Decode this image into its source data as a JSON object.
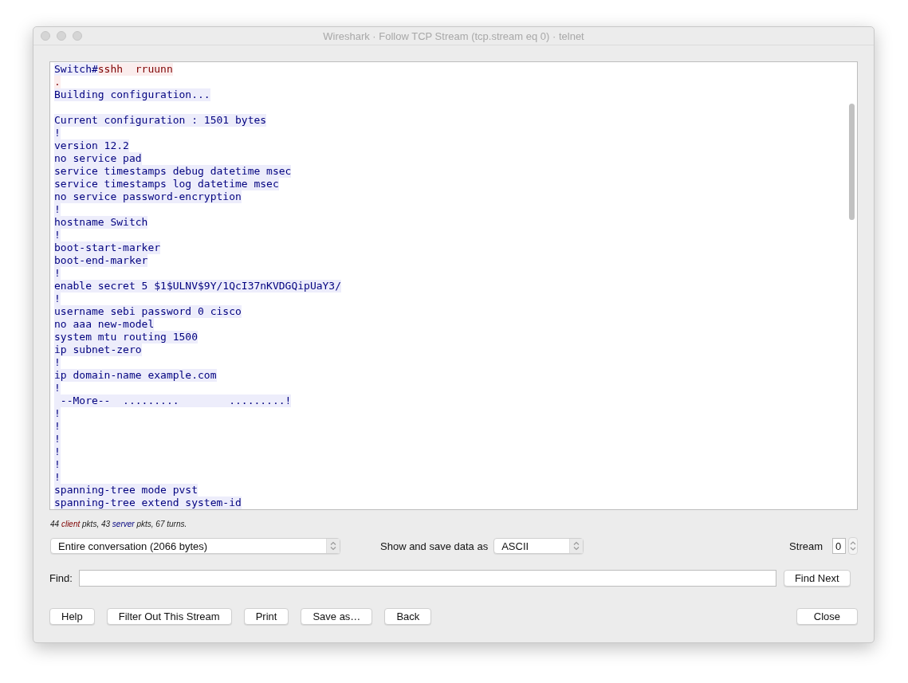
{
  "window": {
    "title": "Wireshark · Follow TCP Stream (tcp.stream eq 0) · telnet"
  },
  "stream": {
    "lines": [
      {
        "segments": [
          {
            "kind": "server",
            "text": "Switch#"
          },
          {
            "kind": "client",
            "text": "sshh  rruunn"
          }
        ]
      },
      {
        "segments": [
          {
            "kind": "client",
            "text": "."
          }
        ]
      },
      {
        "segments": [
          {
            "kind": "server",
            "text": "Building configuration..."
          }
        ]
      },
      {
        "gap_before": true,
        "segments": [
          {
            "kind": "server",
            "text": "Current configuration : 1501 bytes"
          }
        ]
      },
      {
        "segments": [
          {
            "kind": "server",
            "text": "!"
          }
        ]
      },
      {
        "segments": [
          {
            "kind": "server",
            "text": "version 12.2"
          }
        ]
      },
      {
        "segments": [
          {
            "kind": "server",
            "text": "no service pad"
          }
        ]
      },
      {
        "segments": [
          {
            "kind": "server",
            "text": "service timestamps debug datetime msec"
          }
        ]
      },
      {
        "segments": [
          {
            "kind": "server",
            "text": "service timestamps log datetime msec"
          }
        ]
      },
      {
        "segments": [
          {
            "kind": "server",
            "text": "no service password-encryption"
          }
        ]
      },
      {
        "segments": [
          {
            "kind": "server",
            "text": "!"
          }
        ]
      },
      {
        "segments": [
          {
            "kind": "server",
            "text": "hostname Switch"
          }
        ]
      },
      {
        "segments": [
          {
            "kind": "server",
            "text": "!"
          }
        ]
      },
      {
        "segments": [
          {
            "kind": "server",
            "text": "boot-start-marker"
          }
        ]
      },
      {
        "segments": [
          {
            "kind": "server",
            "text": "boot-end-marker"
          }
        ]
      },
      {
        "segments": [
          {
            "kind": "server",
            "text": "!"
          }
        ]
      },
      {
        "segments": [
          {
            "kind": "server",
            "text": "enable secret 5 $1$ULNV$9Y/1QcI37nKVDGQipUaY3/"
          }
        ]
      },
      {
        "segments": [
          {
            "kind": "server",
            "text": "!"
          }
        ]
      },
      {
        "segments": [
          {
            "kind": "server",
            "text": "username sebi password 0 cisco"
          }
        ]
      },
      {
        "segments": [
          {
            "kind": "server",
            "text": "no aaa new-model"
          }
        ]
      },
      {
        "segments": [
          {
            "kind": "server",
            "text": "system mtu routing 1500"
          }
        ]
      },
      {
        "segments": [
          {
            "kind": "server",
            "text": "ip subnet-zero"
          }
        ]
      },
      {
        "segments": [
          {
            "kind": "server",
            "text": "!"
          }
        ]
      },
      {
        "segments": [
          {
            "kind": "server",
            "text": "ip domain-name example.com"
          }
        ]
      },
      {
        "segments": [
          {
            "kind": "server",
            "text": "!"
          }
        ]
      },
      {
        "segments": [
          {
            "kind": "server",
            "text": " --More--  .........        .........!"
          }
        ]
      },
      {
        "segments": [
          {
            "kind": "server",
            "text": "!"
          }
        ]
      },
      {
        "segments": [
          {
            "kind": "server",
            "text": "!"
          }
        ]
      },
      {
        "segments": [
          {
            "kind": "server",
            "text": "!"
          }
        ]
      },
      {
        "segments": [
          {
            "kind": "server",
            "text": "!"
          }
        ]
      },
      {
        "segments": [
          {
            "kind": "server",
            "text": "!"
          }
        ]
      },
      {
        "segments": [
          {
            "kind": "server",
            "text": "!"
          }
        ]
      },
      {
        "segments": [
          {
            "kind": "server",
            "text": "spanning-tree mode pvst"
          }
        ]
      },
      {
        "segments": [
          {
            "kind": "server",
            "text": "spanning-tree extend system-id"
          }
        ]
      }
    ]
  },
  "summary": {
    "segments": [
      {
        "kind": "plain",
        "text": "44 "
      },
      {
        "kind": "client",
        "text": "client"
      },
      {
        "kind": "plain",
        "text": " pkts, 43 "
      },
      {
        "kind": "server",
        "text": "server"
      },
      {
        "kind": "plain",
        "text": " pkts, 67 turns."
      }
    ]
  },
  "conversation_select": {
    "value": "Entire conversation (2066 bytes)"
  },
  "format": {
    "label": "Show and save data as",
    "value": "ASCII"
  },
  "stream_number": {
    "label": "Stream",
    "value": "0"
  },
  "find": {
    "label": "Find:",
    "button": "Find Next"
  },
  "buttons": [
    {
      "label": "Help"
    },
    {
      "label": "Filter Out This Stream"
    },
    {
      "label": "Print"
    },
    {
      "label": "Save as…"
    },
    {
      "label": "Back"
    }
  ],
  "close_button": "Close"
}
